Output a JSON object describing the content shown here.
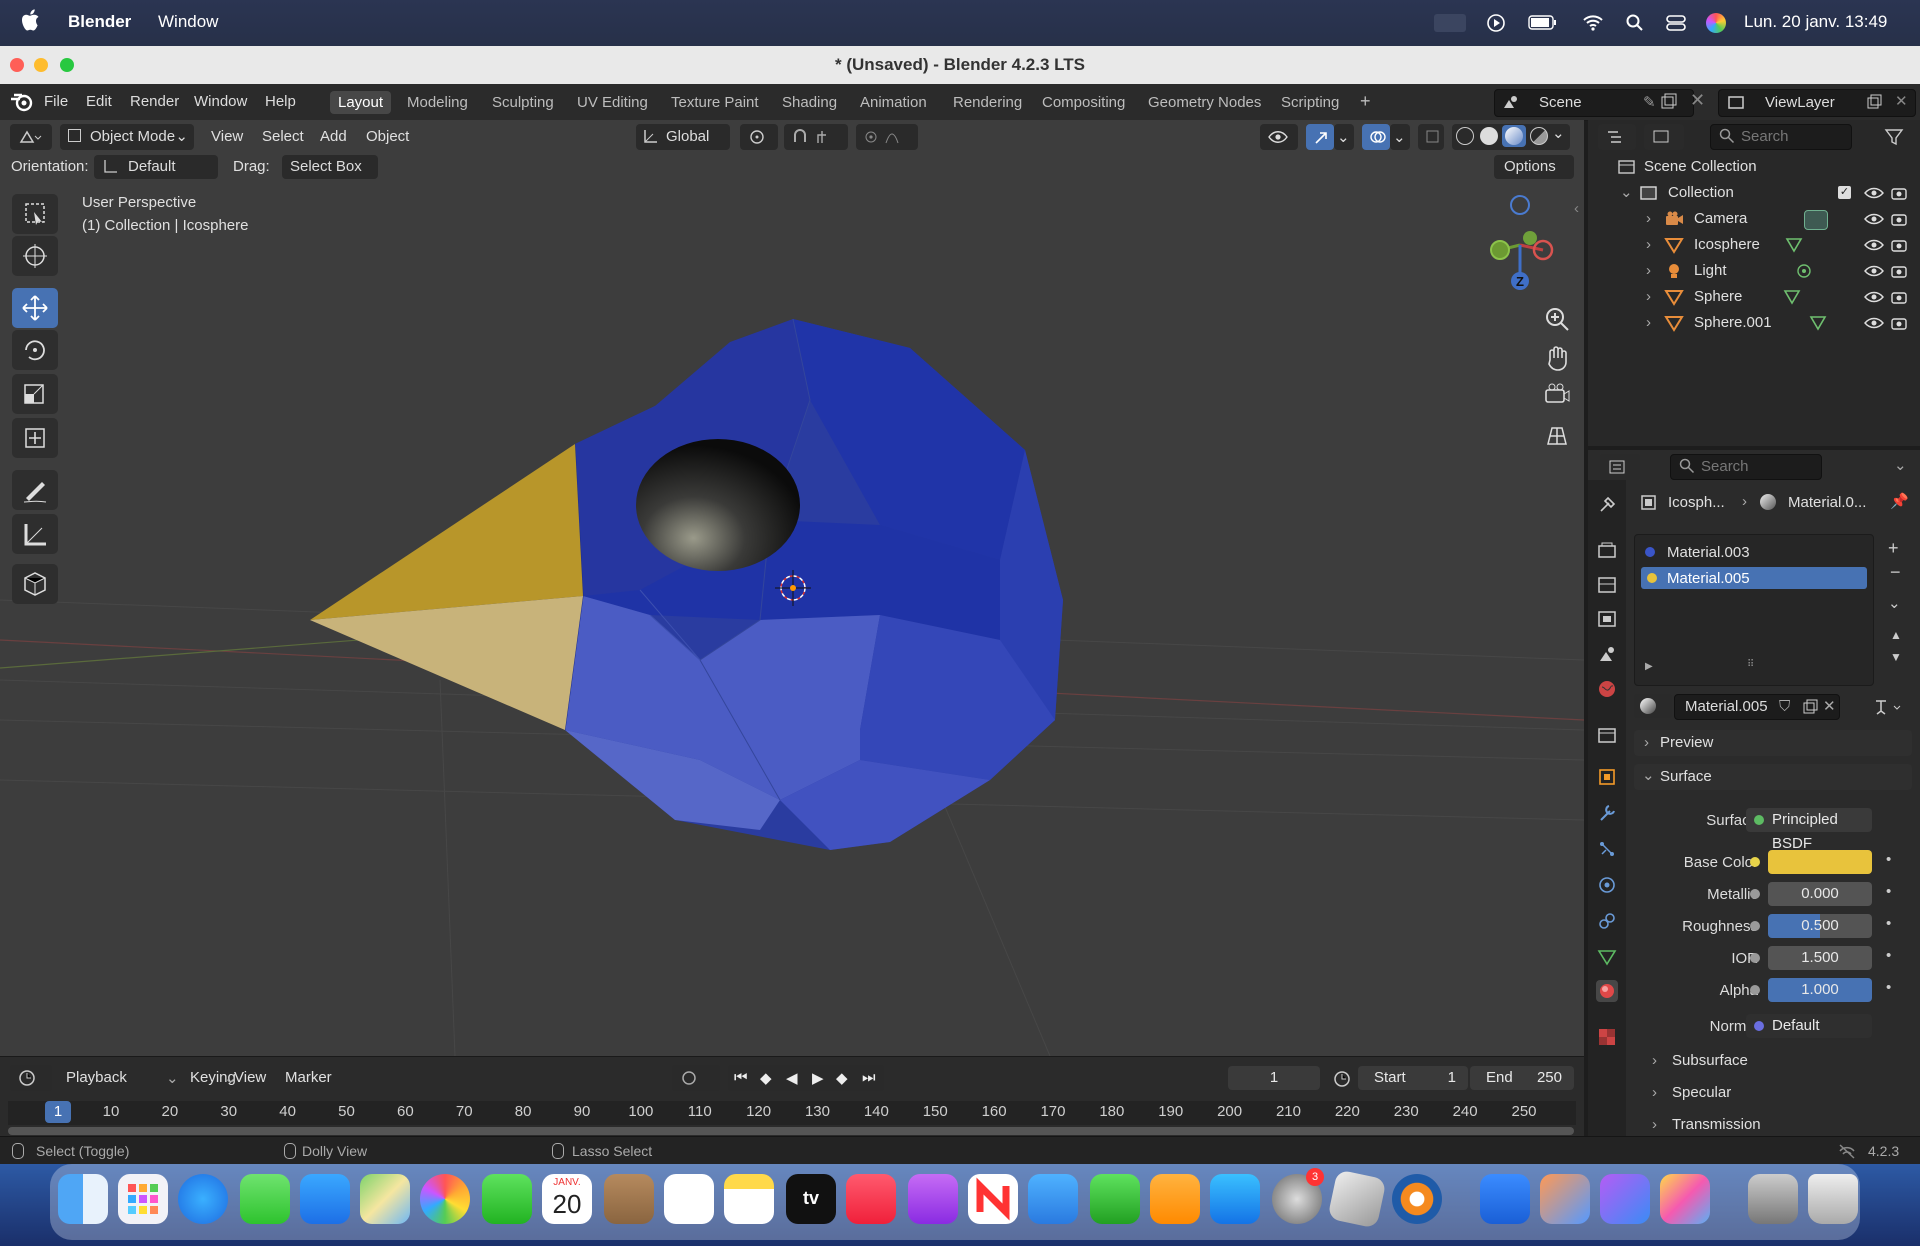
{
  "menubar": {
    "apple": "",
    "app": "Blender",
    "window": "Window",
    "datetime": "Lun. 20 janv.  13:49"
  },
  "titlebar": {
    "title": "* (Unsaved) - Blender 4.2.3 LTS"
  },
  "topbar": {
    "menus": [
      "File",
      "Edit",
      "Render",
      "Window",
      "Help"
    ],
    "workspaces": [
      "Layout",
      "Modeling",
      "Sculpting",
      "UV Editing",
      "Texture Paint",
      "Shading",
      "Animation",
      "Rendering",
      "Compositing",
      "Geometry Nodes",
      "Scripting"
    ],
    "active_workspace": "Layout",
    "add": "+",
    "scene": "Scene",
    "viewlayer": "ViewLayer"
  },
  "viewport": {
    "mode": "Object Mode",
    "menus": [
      "View",
      "Select",
      "Add",
      "Object"
    ],
    "transform_orientation": "Global",
    "orientation_label": "Orientation:",
    "orientation_value": "Default",
    "drag_label": "Drag:",
    "drag_value": "Select Box",
    "options": "Options",
    "overlay_line1": "User Perspective",
    "overlay_line2": "(1) Collection | Icosphere",
    "gizmo_axis_z": "Z",
    "colors": {
      "bg": "#3d3d3d",
      "blue": "#2b3fa8",
      "gold": "#c9a227",
      "accent": "#4772b3"
    }
  },
  "outliner": {
    "search_placeholder": "Search",
    "root": "Scene Collection",
    "collection": "Collection",
    "items": [
      {
        "name": "Camera",
        "icon": "camera-icon"
      },
      {
        "name": "Icosphere",
        "icon": "mesh-icon"
      },
      {
        "name": "Light",
        "icon": "light-icon"
      },
      {
        "name": "Sphere",
        "icon": "mesh-icon"
      },
      {
        "name": "Sphere.001",
        "icon": "mesh-icon"
      }
    ]
  },
  "properties": {
    "search_placeholder": "Search",
    "breadcrumb_object": "Icosph...",
    "breadcrumb_material": "Material.0...",
    "slots": [
      "Material.003",
      "Material.005"
    ],
    "selected_slot": "Material.005",
    "material_name": "Material.005",
    "panel_preview": "Preview",
    "panel_surface": "Surface",
    "surface_label": "Surface",
    "surface_value": "Principled BSDF",
    "fields": [
      {
        "label": "Base Color",
        "value": "",
        "type": "color",
        "color": "#e8c33c"
      },
      {
        "label": "Metallic",
        "value": "0.000",
        "fill": 0.0
      },
      {
        "label": "Roughness",
        "value": "0.500",
        "fill": 0.5
      },
      {
        "label": "IOR",
        "value": "1.500",
        "fill": 0.0
      },
      {
        "label": "Alpha",
        "value": "1.000",
        "fill": 1.0
      }
    ],
    "normal_label": "Normal",
    "normal_value": "Default",
    "subpanels": [
      "Subsurface",
      "Specular",
      "Transmission"
    ]
  },
  "timeline": {
    "menus": [
      "Playback",
      "Keying",
      "View",
      "Marker"
    ],
    "current_frame": "1",
    "start_label": "Start",
    "start": "1",
    "end_label": "End",
    "end": "250",
    "ticks": [
      "1",
      "10",
      "20",
      "30",
      "40",
      "50",
      "60",
      "70",
      "80",
      "90",
      "100",
      "110",
      "120",
      "130",
      "140",
      "150",
      "160",
      "170",
      "180",
      "190",
      "200",
      "210",
      "220",
      "230",
      "240",
      "250"
    ]
  },
  "statusbar": {
    "left": "Select (Toggle)",
    "middle": "Dolly View",
    "right": "Lasso Select",
    "version": "4.2.3"
  },
  "dock": {
    "calendar_month": "JANV.",
    "calendar_day": "20",
    "settings_badge": "3",
    "tv_label": "tv"
  }
}
